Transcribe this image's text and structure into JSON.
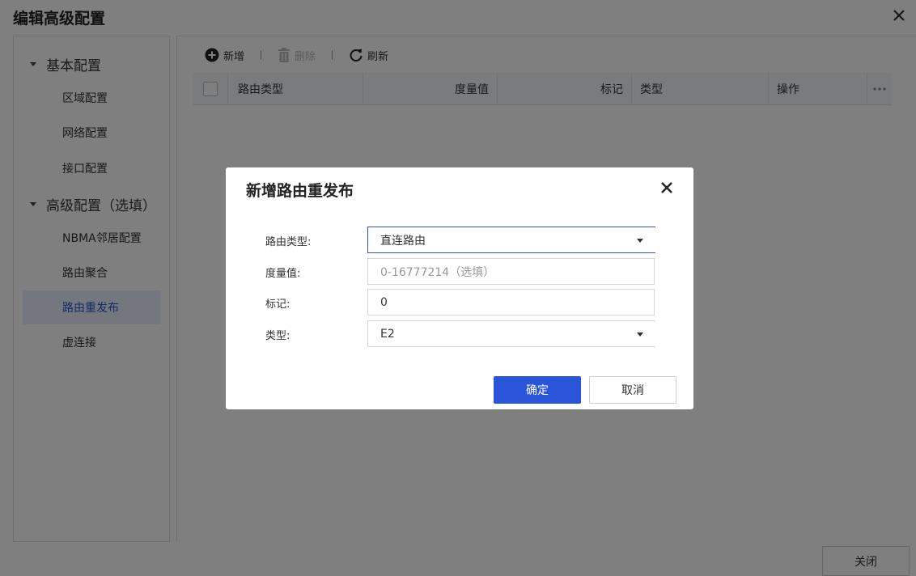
{
  "page": {
    "title": "编辑高级配置",
    "footer_close_label": "关闭"
  },
  "sidebar": {
    "groups": [
      {
        "label": "基本配置",
        "items": [
          "区域配置",
          "网络配置",
          "接口配置"
        ]
      },
      {
        "label": "高级配置（选填）",
        "items": [
          "NBMA邻居配置",
          "路由聚合",
          "路由重发布",
          "虚连接"
        ]
      }
    ],
    "active_item": "路由重发布"
  },
  "toolbar": {
    "add_label": "新增",
    "delete_label": "删除",
    "refresh_label": "刷新"
  },
  "table": {
    "columns": [
      "路由类型",
      "度量值",
      "标记",
      "类型",
      "操作"
    ]
  },
  "modal": {
    "title": "新增路由重发布",
    "fields": {
      "route_type": {
        "label": "路由类型:",
        "value": "直连路由"
      },
      "metric": {
        "label": "度量值:",
        "placeholder": "0-16777214（选填）"
      },
      "tag": {
        "label": "标记:",
        "value": "0"
      },
      "type": {
        "label": "类型:",
        "value": "E2"
      }
    },
    "confirm_label": "确定",
    "cancel_label": "取消"
  },
  "colors": {
    "primary": "#2b55d9",
    "active_bg": "#e9eefb",
    "overlay": "rgba(0,0,0,0.5)"
  }
}
